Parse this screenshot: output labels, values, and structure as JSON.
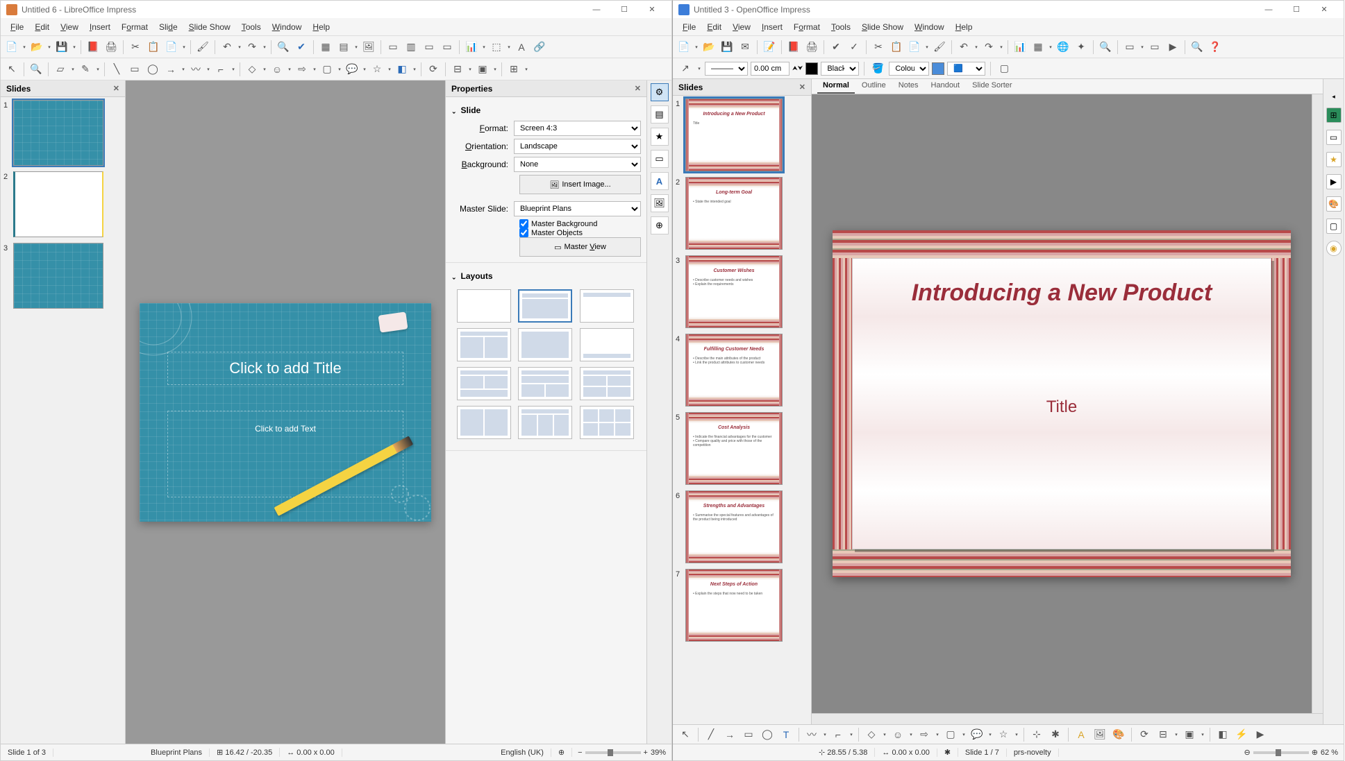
{
  "libre": {
    "title": "Untitled 6 - LibreOffice Impress",
    "menus": [
      "File",
      "Edit",
      "View",
      "Insert",
      "Format",
      "Slide",
      "Slide Show",
      "Tools",
      "Window",
      "Help"
    ],
    "slides_panel_title": "Slides",
    "editor": {
      "title_placeholder": "Click to add Title",
      "text_placeholder": "Click to add Text"
    },
    "thumbs": [
      1,
      2,
      3
    ],
    "properties": {
      "panel_title": "Properties",
      "section_slide": "Slide",
      "format_lbl": "Format:",
      "format_val": "Screen 4:3",
      "orient_lbl": "Orientation:",
      "orient_val": "Landscape",
      "bg_lbl": "Background:",
      "bg_val": "None",
      "insert_img": "Insert Image...",
      "master_lbl": "Master Slide:",
      "master_val": "Blueprint Plans",
      "chk_bg": "Master Background",
      "chk_obj": "Master Objects",
      "master_view": "Master View",
      "section_layouts": "Layouts"
    },
    "status": {
      "slide": "Slide 1 of 3",
      "template": "Blueprint Plans",
      "coords": "16.42 / -20.35",
      "size": "0.00 x 0.00",
      "lang": "English (UK)",
      "zoom": "39%"
    }
  },
  "open": {
    "title": "Untitled 3 - OpenOffice Impress",
    "menus": [
      "File",
      "Edit",
      "View",
      "Insert",
      "Format",
      "Tools",
      "Slide Show",
      "Window",
      "Help"
    ],
    "toolbar2": {
      "width": "0.00 cm",
      "line_color_lbl": "Black",
      "fill_mode": "Colour",
      "fill_val": ""
    },
    "view_tabs": [
      "Normal",
      "Outline",
      "Notes",
      "Handout",
      "Slide Sorter"
    ],
    "slides_panel_title": "Slides",
    "main_slide": {
      "title": "Introducing a New Product",
      "subtitle": "Title"
    },
    "thumbs": [
      {
        "n": 1,
        "title": "Introducing a New Product",
        "body": "Title"
      },
      {
        "n": 2,
        "title": "Long-term Goal",
        "body": "• State the intended goal"
      },
      {
        "n": 3,
        "title": "Customer Wishes",
        "body": "• Describe customer needs and wishes\n• Explain the requirements"
      },
      {
        "n": 4,
        "title": "Fulfilling Customer Needs",
        "body": "• Describe the main attributes of the product\n• Link the product attributes to customer needs"
      },
      {
        "n": 5,
        "title": "Cost Analysis",
        "body": "• Indicate the financial advantages for the customer\n• Compare quality and price with those of the competition"
      },
      {
        "n": 6,
        "title": "Strengths and Advantages",
        "body": "• Summarise the special features and advantages of the product being introduced"
      },
      {
        "n": 7,
        "title": "Next Steps of Action",
        "body": "• Explain the steps that now need to be taken"
      }
    ],
    "status": {
      "coords": "28.55 / 5.38",
      "size": "0.00 x 0.00",
      "slide": "Slide 1 / 7",
      "template": "prs-novelty",
      "zoom": "62 %"
    }
  }
}
